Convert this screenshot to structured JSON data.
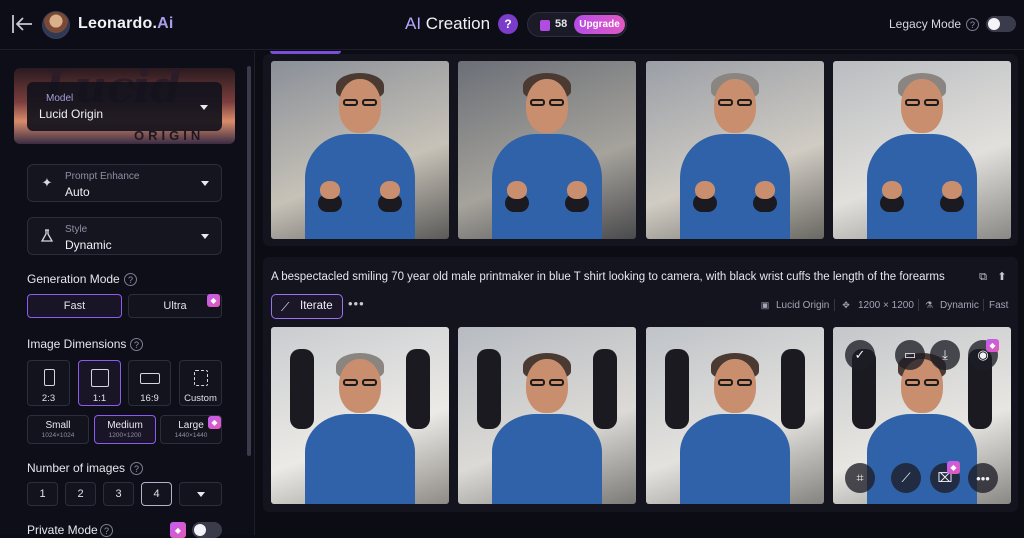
{
  "header": {
    "brand_name": "Leonardo.",
    "brand_suffix": "Ai",
    "title_highlight": "AI",
    "title_rest": " Creation",
    "help_glyph": "?",
    "token_count": "58",
    "upgrade_label": "Upgrade",
    "legacy_mode_label": "Legacy Mode",
    "legacy_mode_on": false
  },
  "sidebar": {
    "model_card_art": "Lucid",
    "model_card_sub": "ORIGIN",
    "model_label": "Model",
    "model_value": "Lucid Origin",
    "prompt_enhance_label": "Prompt Enhance",
    "prompt_enhance_value": "Auto",
    "style_label": "Style",
    "style_value": "Dynamic",
    "generation_mode_label": "Generation Mode",
    "generation_modes": [
      "Fast",
      "Ultra"
    ],
    "generation_mode_selected": "Fast",
    "image_dimensions_label": "Image Dimensions",
    "aspect_ratios": [
      "2:3",
      "1:1",
      "16:9",
      "Custom"
    ],
    "aspect_selected": "1:1",
    "sizes": [
      {
        "name": "Small",
        "res": "1024×1024"
      },
      {
        "name": "Medium",
        "res": "1200×1200"
      },
      {
        "name": "Large",
        "res": "1440×1440"
      }
    ],
    "size_selected": "Medium",
    "number_of_images_label": "Number of images",
    "number_options": [
      "1",
      "2",
      "3",
      "4"
    ],
    "number_selected": "4",
    "private_mode_label": "Private Mode",
    "private_mode_on": false
  },
  "generation": {
    "prompt": "A bespectacled smiling 70 year old male printmaker in blue T shirt looking to camera, with black wrist cuffs the length of the forearms",
    "iterate_label": "Iterate",
    "more_label": "•••",
    "meta_model": "Lucid Origin",
    "meta_size": "1200 × 1200",
    "meta_style": "Dynamic",
    "meta_mode": "Fast"
  },
  "icons": {
    "back": "arrow-left-icon",
    "sparkle": "sparkle-icon",
    "flask": "flask-icon",
    "copy": "copy-icon",
    "pin": "pin-icon",
    "wand": "magic-wand-icon",
    "check": "check-icon",
    "folder": "folder-icon",
    "download": "download-icon",
    "eye": "eye-icon",
    "scan": "scan-icon",
    "crop": "crop-icon",
    "more": "more-icon",
    "gem": "gem-icon"
  },
  "colors": {
    "accent": "#8a5cf0",
    "upgrade_gradient_start": "#b54ce6",
    "upgrade_gradient_end": "#e159c4",
    "shirt_blue": "#2f62a8",
    "background": "#0b0c14"
  }
}
